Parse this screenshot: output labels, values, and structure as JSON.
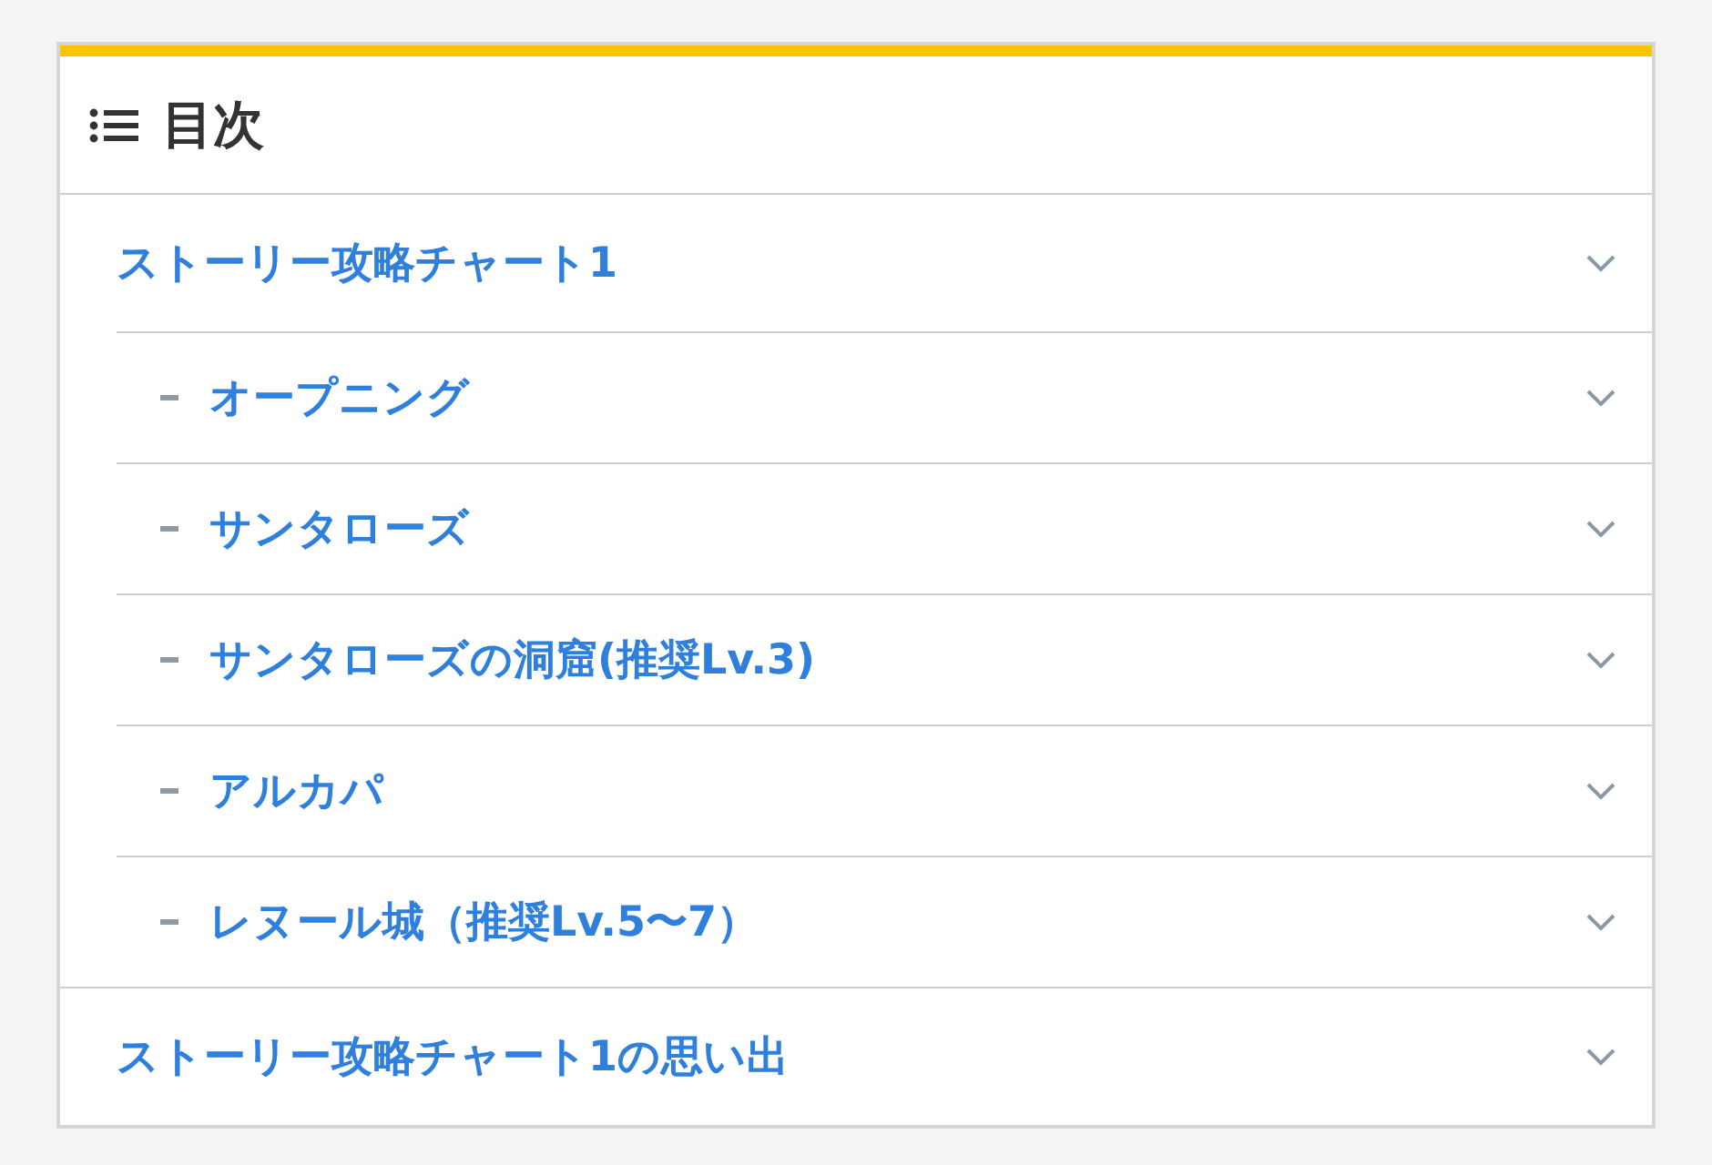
{
  "toc": {
    "title": "目次",
    "items": [
      {
        "label": "ストーリー攻略チャート1",
        "children": [
          {
            "label": "オープニング"
          },
          {
            "label": "サンタローズ"
          },
          {
            "label": "サンタローズの洞窟(推奨Lv.3)"
          },
          {
            "label": "アルカパ"
          },
          {
            "label": "レヌール城（推奨Lv.5〜7）"
          }
        ]
      },
      {
        "label": "ストーリー攻略チャート1の思い出"
      }
    ]
  }
}
